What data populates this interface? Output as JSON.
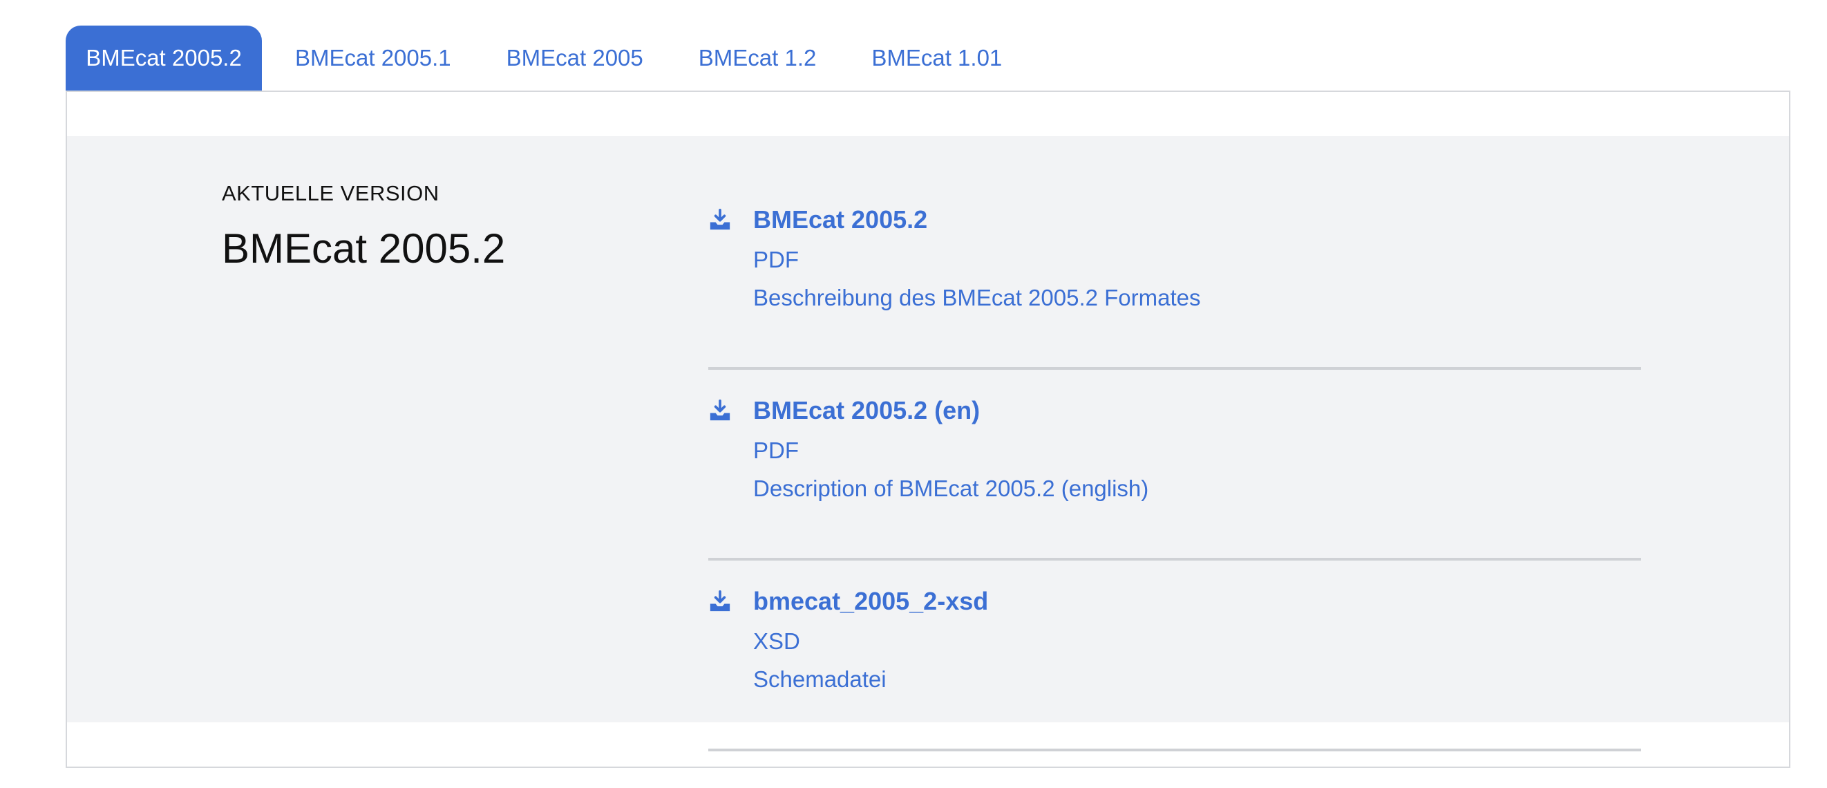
{
  "tabs": [
    {
      "label": "BMEcat 2005.2",
      "active": true
    },
    {
      "label": "BMEcat 2005.1",
      "active": false
    },
    {
      "label": "BMEcat 2005",
      "active": false
    },
    {
      "label": "BMEcat 1.2",
      "active": false
    },
    {
      "label": "BMEcat 1.01",
      "active": false
    }
  ],
  "colors": {
    "accent": "#3b6fd4",
    "panel_bg": "#f2f3f5",
    "divider": "#cfd1d5"
  },
  "current": {
    "label": "AKTUELLE VERSION",
    "title": "BMEcat 2005.2"
  },
  "downloads": [
    {
      "icon": "download-icon",
      "title": "BMEcat 2005.2",
      "format": "PDF",
      "description": "Beschreibung des BMEcat 2005.2 Formates"
    },
    {
      "icon": "download-icon",
      "title": "BMEcat 2005.2 (en)",
      "format": "PDF",
      "description": "Description of BMEcat 2005.2 (english)"
    },
    {
      "icon": "download-icon",
      "title": "bmecat_2005_2-xsd",
      "format": "XSD",
      "description": "Schemadatei"
    }
  ]
}
